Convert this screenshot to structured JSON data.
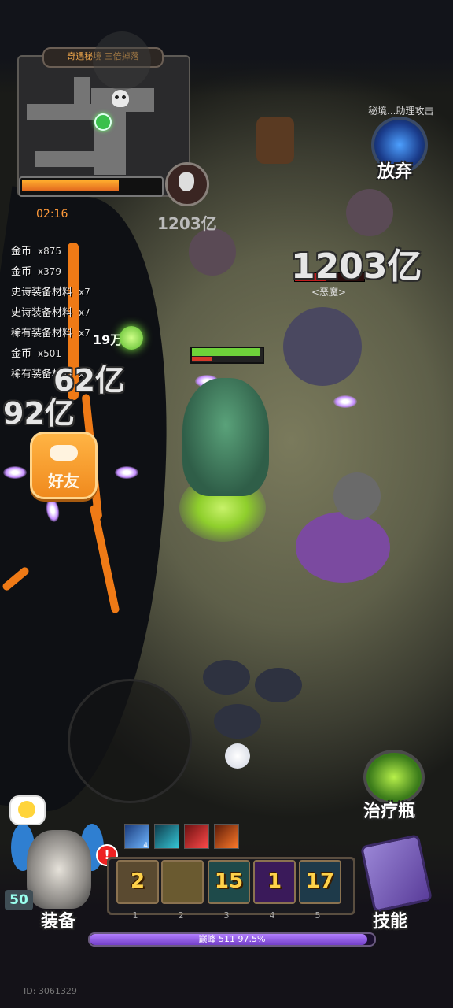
{
  "minimap": {
    "title": "奇遇秘境 三倍掉落",
    "timer": "02:16",
    "progress": 0.7
  },
  "boss": {
    "hp_text": "1203亿"
  },
  "enemy": {
    "damage_text": "1203亿",
    "tag": "<恶魔>",
    "hp": 0.45
  },
  "top_right_text": "秘境...助理攻击",
  "loot": [
    {
      "name": "金币",
      "qty": "x875"
    },
    {
      "name": "金币",
      "qty": "x379"
    },
    {
      "name": "史诗装备材料",
      "qty": "x7"
    },
    {
      "name": "史诗装备材料",
      "qty": "x7"
    },
    {
      "name": "稀有装备材料",
      "qty": "x7"
    },
    {
      "name": "金币",
      "qty": "x501"
    },
    {
      "name": "稀有装备材料",
      "qty": "x7"
    }
  ],
  "floating": {
    "heal_gain": "19万",
    "damage_a": "62亿",
    "damage_b": "92亿"
  },
  "buttons": {
    "friend": "好友",
    "abandon": "放弃",
    "potion": "治疗瓶",
    "equipment": "装备",
    "skills": "技能"
  },
  "player": {
    "hp": 1.0,
    "mp": 0.3,
    "level": "50"
  },
  "buff_counts": [
    "4",
    "",
    "",
    ""
  ],
  "skill_slots": [
    {
      "value": "2",
      "key": "1"
    },
    {
      "value": "",
      "key": "2"
    },
    {
      "value": "15",
      "key": "3"
    },
    {
      "value": "1",
      "key": "4"
    },
    {
      "value": "17",
      "key": "5"
    }
  ],
  "xp": {
    "text": "巅峰 511  97.5%",
    "fraction": 0.975
  },
  "alert": "!",
  "id_text": "ID: 3061329"
}
